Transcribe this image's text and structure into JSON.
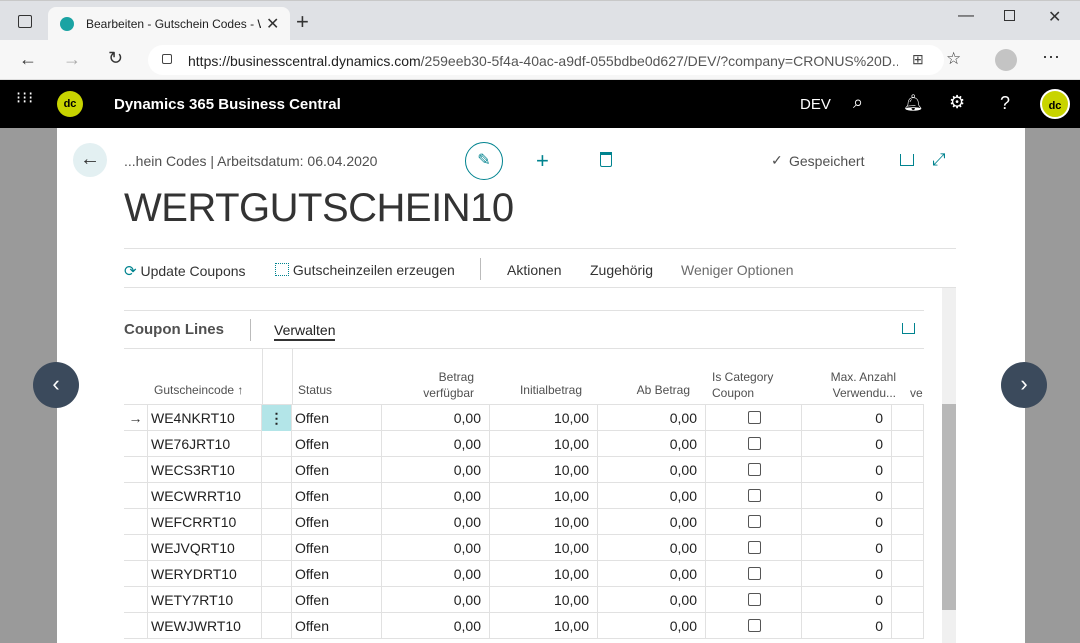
{
  "browser": {
    "tab_title": "Bearbeiten - Gutschein Codes - W",
    "url_host": "https://businesscentral.dynamics.com",
    "url_path": "/259eeb30-5f4a-40ac-a9df-055bdbe0d627/DEV/?company=CRONUS%20D..."
  },
  "app": {
    "title": "Dynamics 365 Business Central",
    "logo_text": "dc",
    "environment": "DEV"
  },
  "page": {
    "breadcrumb": "...hein Codes | Arbeitsdatum: 06.04.2020",
    "saved_label": "Gespeichert",
    "title": "WERTGUTSCHEIN10"
  },
  "actions": {
    "update_coupons": "Update Coupons",
    "generate_lines": "Gutscheinzeilen erzeugen",
    "aktionen": "Aktionen",
    "zugehoerig": "Zugehörig",
    "fewer_options": "Weniger Optionen"
  },
  "part": {
    "title": "Coupon Lines",
    "tab_manage": "Verwalten"
  },
  "table": {
    "columns": {
      "code": "Gutscheincode",
      "code_sort": "↑",
      "status": "Status",
      "available_1": "Betrag",
      "available_2": "verfügbar",
      "initial": "Initialbetrag",
      "from": "Ab Betrag",
      "category_1": "Is Category",
      "category_2": "Coupon",
      "maxuse_1": "Max. Anzahl",
      "maxuse_2": "Verwendu...",
      "more": "ve"
    },
    "rows": [
      {
        "code": "WE4NKRT10",
        "status": "Offen",
        "available": "0,00",
        "initial": "10,00",
        "from": "0,00",
        "category": false,
        "maxuse": "0"
      },
      {
        "code": "WE76JRT10",
        "status": "Offen",
        "available": "0,00",
        "initial": "10,00",
        "from": "0,00",
        "category": false,
        "maxuse": "0"
      },
      {
        "code": "WECS3RT10",
        "status": "Offen",
        "available": "0,00",
        "initial": "10,00",
        "from": "0,00",
        "category": false,
        "maxuse": "0"
      },
      {
        "code": "WECWRRT10",
        "status": "Offen",
        "available": "0,00",
        "initial": "10,00",
        "from": "0,00",
        "category": false,
        "maxuse": "0"
      },
      {
        "code": "WEFCRRT10",
        "status": "Offen",
        "available": "0,00",
        "initial": "10,00",
        "from": "0,00",
        "category": false,
        "maxuse": "0"
      },
      {
        "code": "WEJVQRT10",
        "status": "Offen",
        "available": "0,00",
        "initial": "10,00",
        "from": "0,00",
        "category": false,
        "maxuse": "0"
      },
      {
        "code": "WERYDRT10",
        "status": "Offen",
        "available": "0,00",
        "initial": "10,00",
        "from": "0,00",
        "category": false,
        "maxuse": "0"
      },
      {
        "code": "WETY7RT10",
        "status": "Offen",
        "available": "0,00",
        "initial": "10,00",
        "from": "0,00",
        "category": false,
        "maxuse": "0"
      },
      {
        "code": "WEWJWRT10",
        "status": "Offen",
        "available": "0,00",
        "initial": "10,00",
        "from": "0,00",
        "category": false,
        "maxuse": "0"
      }
    ]
  },
  "colors": {
    "accent": "#00838f",
    "header_bg": "#000000",
    "logo": "#c8d400"
  }
}
